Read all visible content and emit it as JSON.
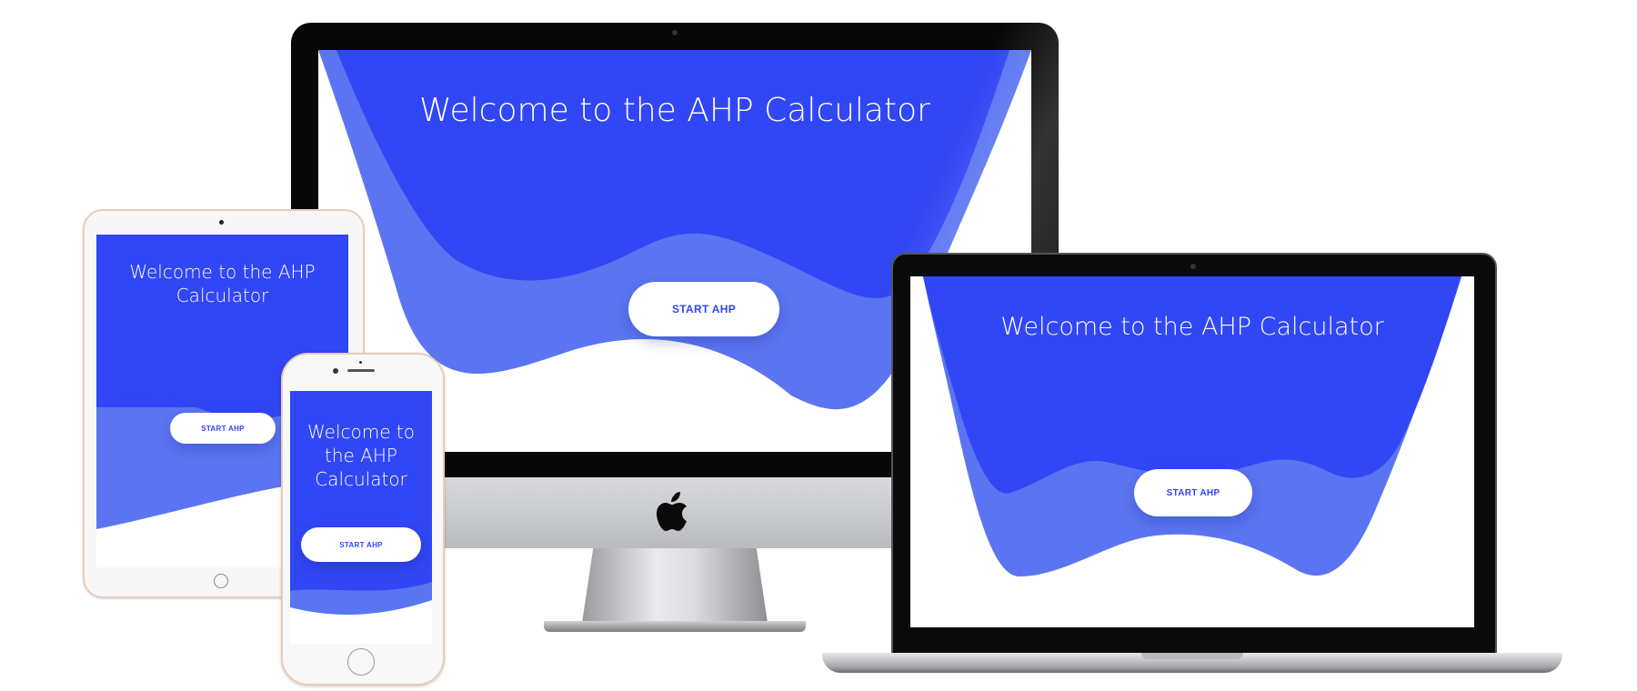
{
  "app": {
    "title": "Welcome to the AHP Calculator",
    "button_label": "START AHP"
  },
  "colors": {
    "primary_blue": "#3146f5",
    "secondary_blue": "#5b75f2",
    "background": "#ffffff"
  },
  "devices": {
    "desktop": {
      "title": "Welcome to the AHP Calculator",
      "button_label": "START AHP",
      "logo_icon": "apple-logo-icon"
    },
    "tablet": {
      "title": "Welcome to the AHP Calculator",
      "button_label": "START AHP"
    },
    "phone": {
      "title": "Welcome to the AHP Calculator",
      "button_label": "START AHP"
    },
    "laptop": {
      "title": "Welcome to the AHP Calculator",
      "button_label": "START AHP"
    }
  }
}
